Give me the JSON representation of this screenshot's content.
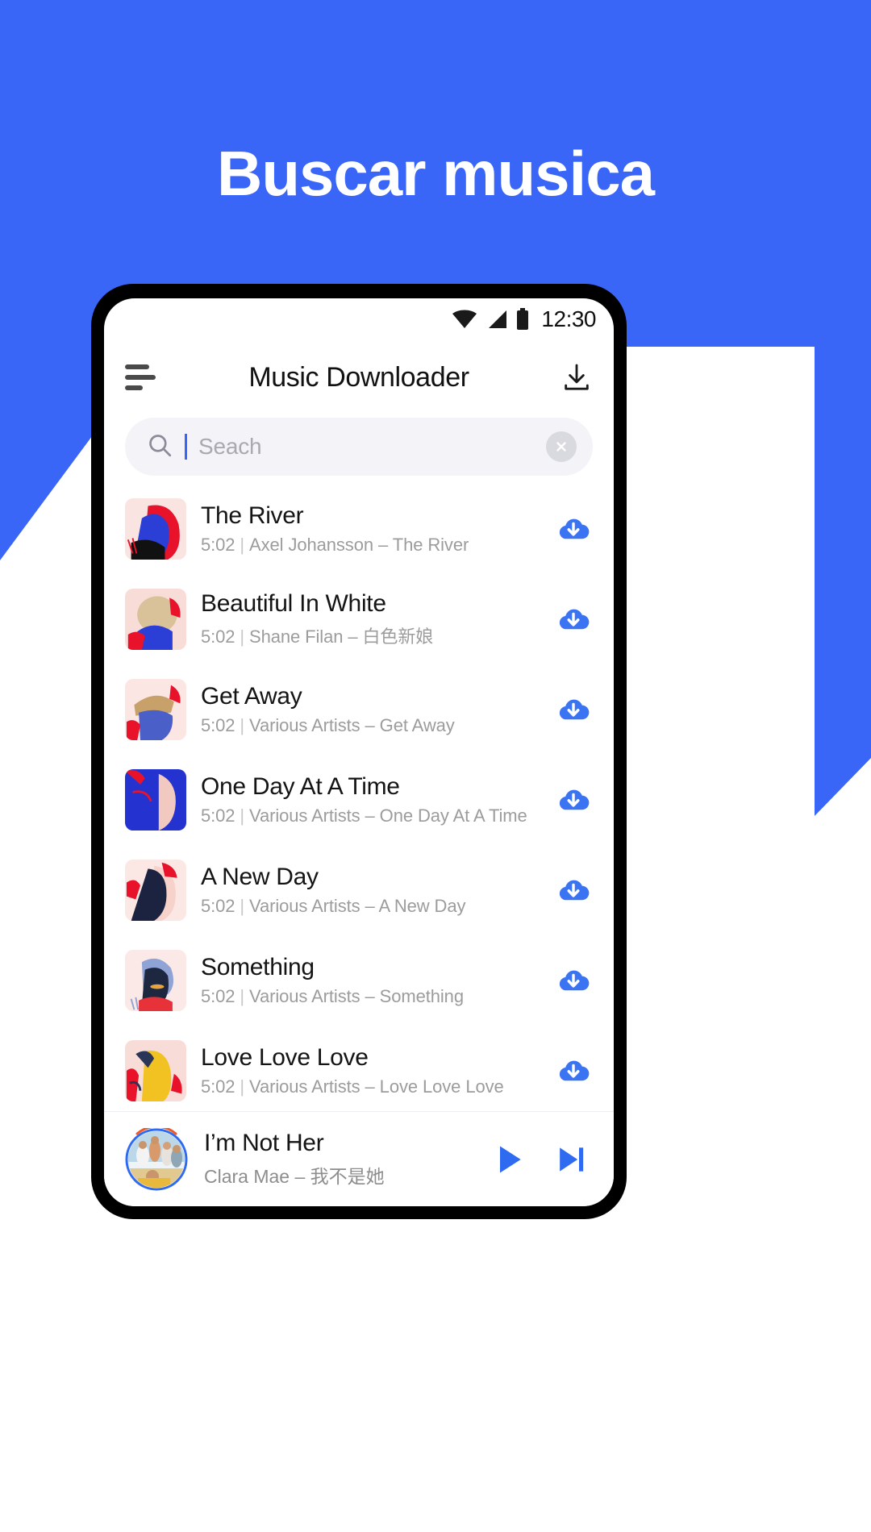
{
  "promo": {
    "headline": "Buscar musica",
    "bg_color": "#3A66F7",
    "headline_color": "#FFFFFF"
  },
  "statusbar": {
    "time": "12:30",
    "icons": [
      "wifi-icon",
      "signal-icon",
      "battery-icon"
    ]
  },
  "appbar": {
    "menu_icon": "hamburger-menu-icon",
    "title": "Music Downloader",
    "action_icon": "download-icon"
  },
  "search": {
    "icon": "search-icon",
    "placeholder": "Seach",
    "value": "",
    "clear_icon": "close-circle-icon",
    "caret_color": "#3A66F7",
    "field_bg": "#F4F3F8"
  },
  "songs": [
    {
      "title": "The River",
      "duration": "5:02",
      "separator": "|",
      "artist_line": "Axel Johansson – The River",
      "download_icon": "cloud-download-icon",
      "art": {
        "bg": "#FAE4E2",
        "a": "#E8122A",
        "b": "#2B3FD6",
        "c": "#111111",
        "variant": 1
      }
    },
    {
      "title": "Beautiful In White",
      "duration": "5:02",
      "separator": "|",
      "artist_line": "Shane Filan –  白色新娘",
      "download_icon": "cloud-download-icon",
      "art": {
        "bg": "#F8DCD8",
        "a": "#E8122A",
        "b": "#2B3FD6",
        "c": "#D9C29A",
        "variant": 2
      }
    },
    {
      "title": "Get Away",
      "duration": "5:02",
      "separator": "|",
      "artist_line": "Various Artists – Get Away",
      "download_icon": "cloud-download-icon",
      "art": {
        "bg": "#FBE6E3",
        "a": "#E8122A",
        "b": "#4A5FC8",
        "c": "#C7A06A",
        "variant": 3
      }
    },
    {
      "title": "One Day At  A Time",
      "duration": "5:02",
      "separator": "|",
      "artist_line": "Various Artists – One Day At A Time",
      "download_icon": "cloud-download-icon",
      "art": {
        "bg": "#F6E0DC",
        "a": "#E8122A",
        "b": "#2433CF",
        "c": "#F2C9C0",
        "variant": 4
      }
    },
    {
      "title": "A New Day",
      "duration": "5:02",
      "separator": "|",
      "artist_line": "Various Artists – A New Day",
      "download_icon": "cloud-download-icon",
      "art": {
        "bg": "#FBE8E5",
        "a": "#E8122A",
        "b": "#1B2340",
        "c": "#F6D2CB",
        "variant": 5
      }
    },
    {
      "title": "Something",
      "duration": "5:02",
      "separator": "|",
      "artist_line": "Various Artists – Something",
      "download_icon": "cloud-download-icon",
      "art": {
        "bg": "#FAE9E6",
        "a": "#E8323A",
        "b": "#8FA3D6",
        "c": "#1E2740",
        "variant": 6
      }
    },
    {
      "title": "Love Love Love",
      "duration": "5:02",
      "separator": "|",
      "artist_line": "Various Artists – Love Love Love",
      "download_icon": "cloud-download-icon",
      "art": {
        "bg": "#F7DCD8",
        "a": "#E8122A",
        "b": "#F2C223",
        "c": "#2A3558",
        "variant": 7
      }
    }
  ],
  "player": {
    "title": "I’m Not Her",
    "subtitle": "Clara Mae – 我不是她",
    "play_icon": "play-icon",
    "next_icon": "skip-next-icon",
    "accent_color": "#2F6BF0",
    "progress_color": "#EE5A28"
  }
}
